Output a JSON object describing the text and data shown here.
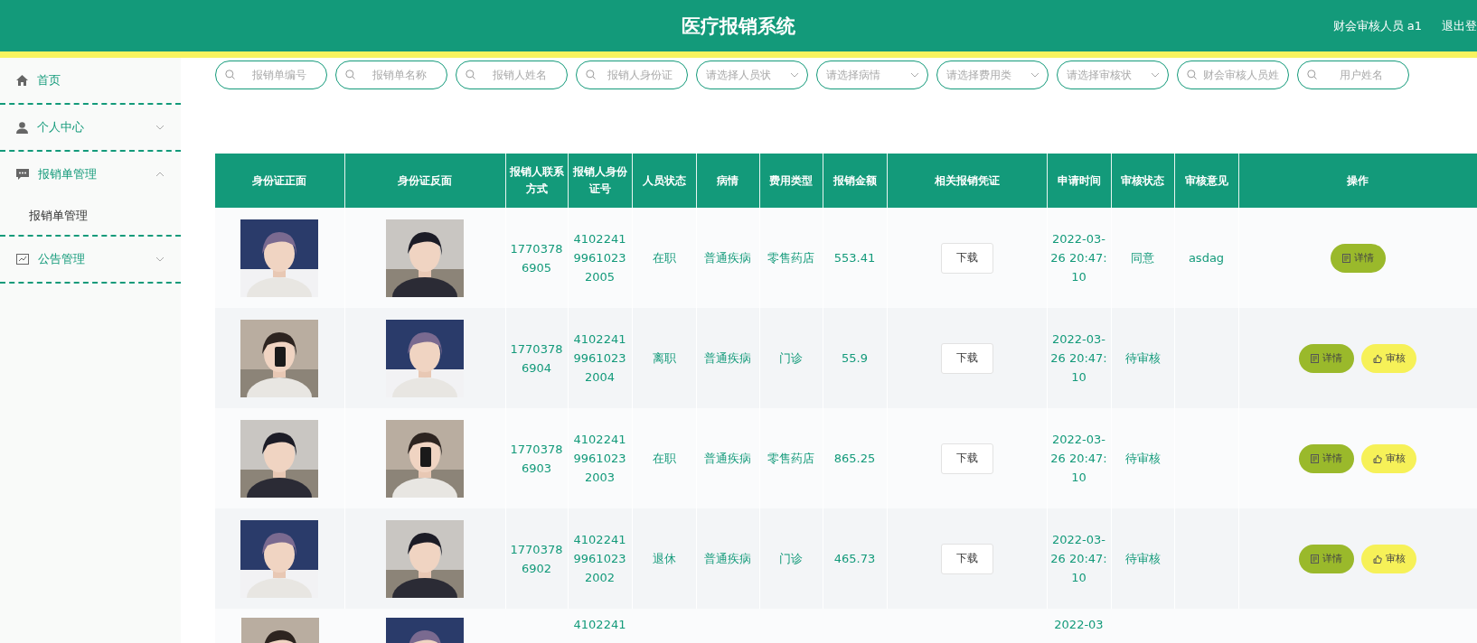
{
  "header": {
    "title": "医疗报销系统",
    "user": "财会审核人员 a1",
    "logout": "退出登"
  },
  "sidebar": {
    "items": [
      {
        "kind": "home",
        "label": "首页"
      },
      {
        "kind": "user",
        "label": "个人中心",
        "expanded": false
      },
      {
        "kind": "chat",
        "label": "报销单管理",
        "expanded": true,
        "children": [
          {
            "label": "报销单管理"
          }
        ]
      },
      {
        "kind": "notice",
        "label": "公告管理",
        "expanded": false
      }
    ]
  },
  "filters": [
    {
      "kind": "input",
      "placeholder": "报销单编号"
    },
    {
      "kind": "input",
      "placeholder": "报销单名称"
    },
    {
      "kind": "input",
      "placeholder": "报销人姓名"
    },
    {
      "kind": "input",
      "placeholder": "报销人身份证"
    },
    {
      "kind": "select",
      "placeholder": "请选择人员状"
    },
    {
      "kind": "select",
      "placeholder": "请选择病情"
    },
    {
      "kind": "select",
      "placeholder": "请选择费用类"
    },
    {
      "kind": "select",
      "placeholder": "请选择审核状"
    },
    {
      "kind": "input",
      "placeholder": "财会审核人员姓"
    },
    {
      "kind": "input",
      "placeholder": "用户姓名"
    }
  ],
  "table": {
    "columns": [
      "身份证正面",
      "身份证反面",
      "报销人联系方式",
      "报销人身份证号",
      "人员状态",
      "病情",
      "费用类型",
      "报销金额",
      "相关报销凭证",
      "申请时间",
      "审核状态",
      "审核意见",
      "操作"
    ],
    "rows": [
      {
        "front": {
          "kind": "picture"
        },
        "back": {
          "kind": "picture"
        },
        "phone": "17703786905",
        "id_no": "410224199610232005",
        "status": "在职",
        "illness": "普通疾病",
        "fee_type": "零售药店",
        "amount": "553.41",
        "voucher": "下载",
        "time": "2022-03-26 20:47:10",
        "review_status": "同意",
        "opinion": "asdag",
        "actions": [
          {
            "kind": "detail",
            "label": "详情"
          }
        ]
      },
      {
        "front": {
          "kind": "picture"
        },
        "back": {
          "kind": "picture"
        },
        "phone": "17703786904",
        "id_no": "410224199610232004",
        "status": "离职",
        "illness": "普通疾病",
        "fee_type": "门诊",
        "amount": "55.9",
        "voucher": "下载",
        "time": "2022-03-26 20:47:10",
        "review_status": "待审核",
        "actions": [
          {
            "kind": "detail",
            "label": "详情"
          },
          {
            "kind": "review",
            "label": "审核"
          }
        ]
      },
      {
        "front": {
          "kind": "picture"
        },
        "back": {
          "kind": "picture"
        },
        "phone": "17703786903",
        "id_no": "410224199610232003",
        "status": "在职",
        "illness": "普通疾病",
        "fee_type": "零售药店",
        "amount": "865.25",
        "voucher": "下载",
        "time": "2022-03-26 20:47:10",
        "review_status": "待审核",
        "actions": [
          {
            "kind": "detail",
            "label": "详情"
          },
          {
            "kind": "review",
            "label": "审核"
          }
        ]
      },
      {
        "front": {
          "kind": "picture"
        },
        "back": {
          "kind": "picture"
        },
        "phone": "17703786902",
        "id_no": "410224199610232002",
        "status": "退休",
        "illness": "普通疾病",
        "fee_type": "门诊",
        "amount": "465.73",
        "voucher": "下载",
        "time": "2022-03-26 20:47:10",
        "review_status": "待审核",
        "actions": [
          {
            "kind": "detail",
            "label": "详情"
          },
          {
            "kind": "review",
            "label": "审核"
          }
        ]
      }
    ],
    "partial_row": {
      "front": {
        "kind": "picture"
      },
      "back": {
        "kind": "picture"
      },
      "id_no": "4102241",
      "time": "2022-03"
    }
  }
}
